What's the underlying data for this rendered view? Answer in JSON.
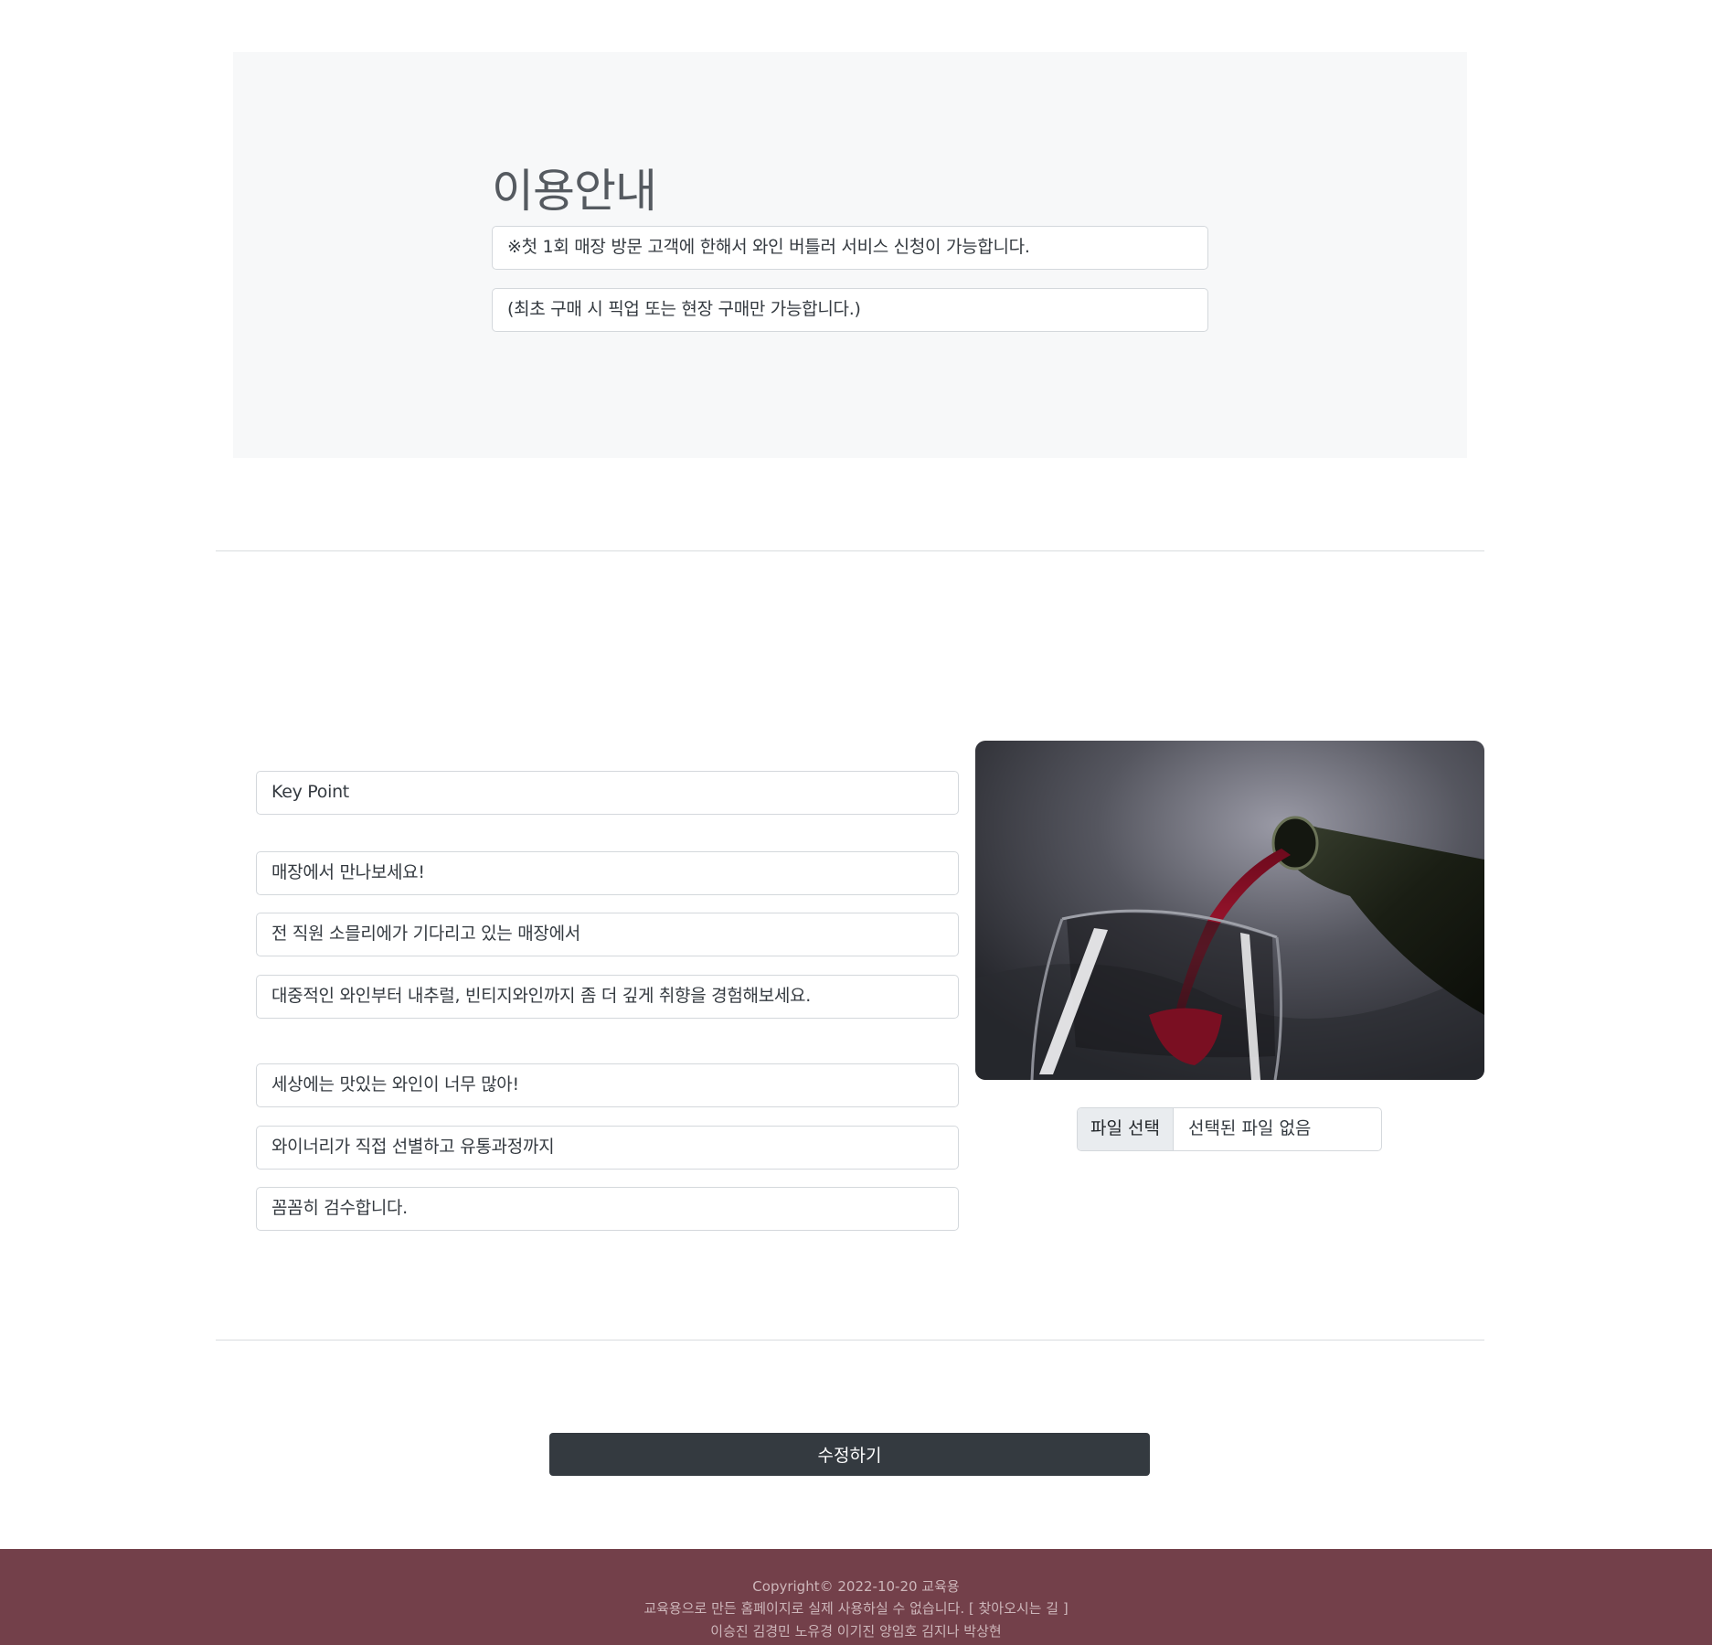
{
  "info": {
    "title": "이용안내",
    "notes": [
      "※첫 1회 매장 방문 고객에 한해서 와인 버틀러 서비스 신청이 가능합니다.",
      "(최초 구매 시 픽업 또는 현장 구매만 가능합니다.)"
    ]
  },
  "content": {
    "key_point": "Key Point",
    "group1": [
      "매장에서 만나보세요!",
      "전 직원 소믈리에가 기다리고 있는 매장에서",
      "대중적인 와인부터 내추럴, 빈티지와인까지 좀 더 깊게 취향을 경험해보세요."
    ],
    "group2": [
      "세상에는 맛있는 와인이 너무 많아!",
      "와이너리가 직접 선별하고 유통과정까지",
      "꼼꼼히 검수합니다."
    ],
    "photo": {
      "subject": "red wine pouring from bottle into glass",
      "colors": {
        "background": "#4a4b55",
        "wine": "#8a1228",
        "bottle": "#1c2016"
      }
    }
  },
  "file_input": {
    "button_label": "파일 선택",
    "status": "선택된 파일 없음"
  },
  "submit_label": "수정하기",
  "footer": {
    "line1": "Copyright© 2022-10-20 교육용",
    "line2": "교육용으로 만든 홈페이지로 실제 사용하실 수 없습니다. [ 찾아오시는 길 ]",
    "line3": "이승진 김경민 노유경 이기진 양임호 김지나 박상현"
  },
  "colors": {
    "panel_bg": "#f7f8f9",
    "button_bg": "#343a40",
    "footer_bg": "#73404a",
    "footer_text": "#cdb6ba"
  }
}
